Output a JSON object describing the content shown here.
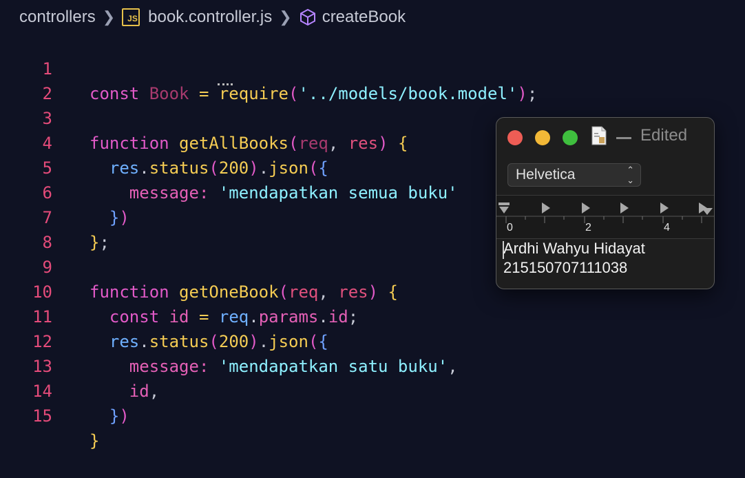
{
  "breadcrumb": {
    "folder": "controllers",
    "file_icon": "JS",
    "file": "book.controller.js",
    "symbol": "createBook"
  },
  "editor": {
    "line_numbers": [
      "1",
      "2",
      "3",
      "4",
      "5",
      "6",
      "7",
      "8",
      "9",
      "10",
      "11",
      "12",
      "13",
      "14",
      "15"
    ],
    "code": {
      "l1": {
        "kw": "const",
        "name": "Book",
        "op": "=",
        "fn": "require",
        "str": "'../models/book.model'",
        "end": ";"
      },
      "l3": {
        "kw": "function",
        "fn": "getAllBooks",
        "p1": "req",
        "p2": "res"
      },
      "l4": {
        "obj": "res",
        "m1": "status",
        "num": "200",
        "m2": "json"
      },
      "l5": {
        "key": "message:",
        "str": "'mendapatkan semua buku'"
      },
      "l9": {
        "kw": "function",
        "fn": "getOneBook",
        "p1": "req",
        "p2": "res"
      },
      "l10": {
        "kw": "const",
        "name": "id",
        "op": "=",
        "obj": "req",
        "p": "params",
        "id": "id"
      },
      "l11": {
        "obj": "res",
        "m1": "status",
        "num": "200",
        "m2": "json"
      },
      "l12": {
        "key": "message:",
        "str": "'mendapatkan satu buku'"
      },
      "l13": {
        "id": "id"
      }
    }
  },
  "textedit": {
    "title": "Edited",
    "font": "Helvetica",
    "ruler_labels": [
      "0",
      "2",
      "4"
    ],
    "lines": [
      "Ardhi Wahyu Hidayat",
      "215150707111038"
    ]
  }
}
